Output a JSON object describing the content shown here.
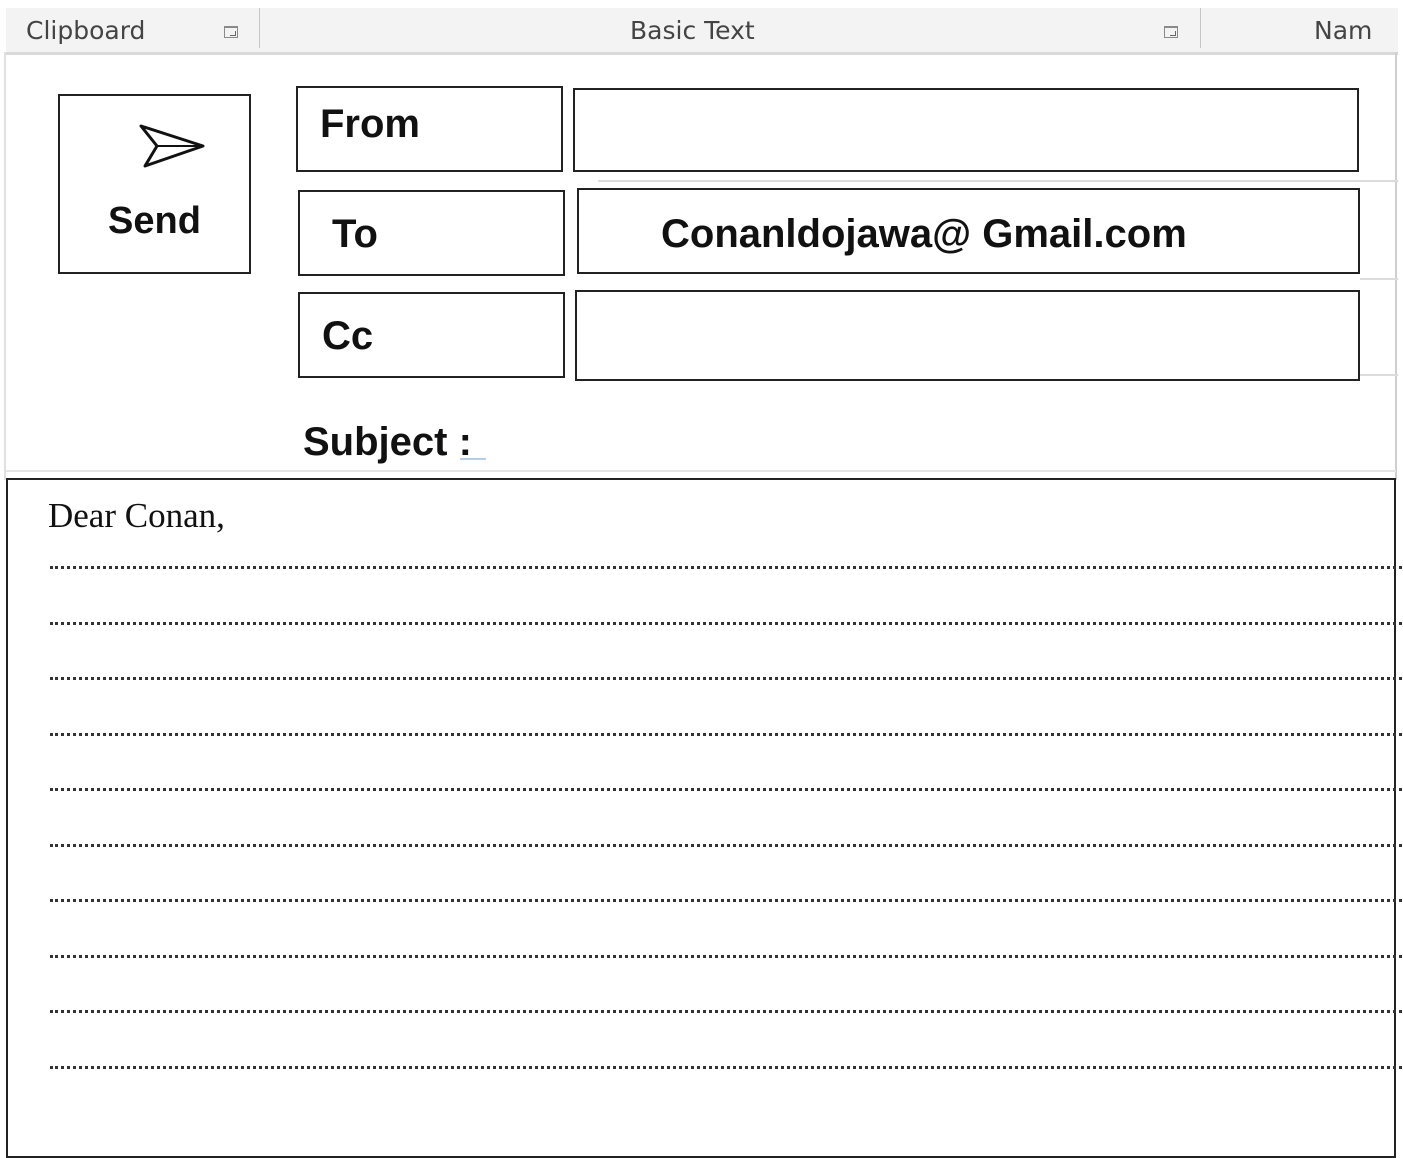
{
  "ribbon": {
    "groups": [
      "Clipboard",
      "Basic Text",
      "Nam"
    ]
  },
  "send": {
    "label": "Send"
  },
  "fields": {
    "from": {
      "label": "From",
      "value": ""
    },
    "to": {
      "label": "To",
      "value": "Conanldojawa@ Gmail.com"
    },
    "cc": {
      "label": "Cc",
      "value": ""
    }
  },
  "subject": {
    "label": "Subject :"
  },
  "body": {
    "greeting": "Dear Conan,",
    "dotted_line_count": 10
  },
  "icons": {
    "send": "send-arrow-icon",
    "launcher": "dialog-launcher-icon"
  }
}
